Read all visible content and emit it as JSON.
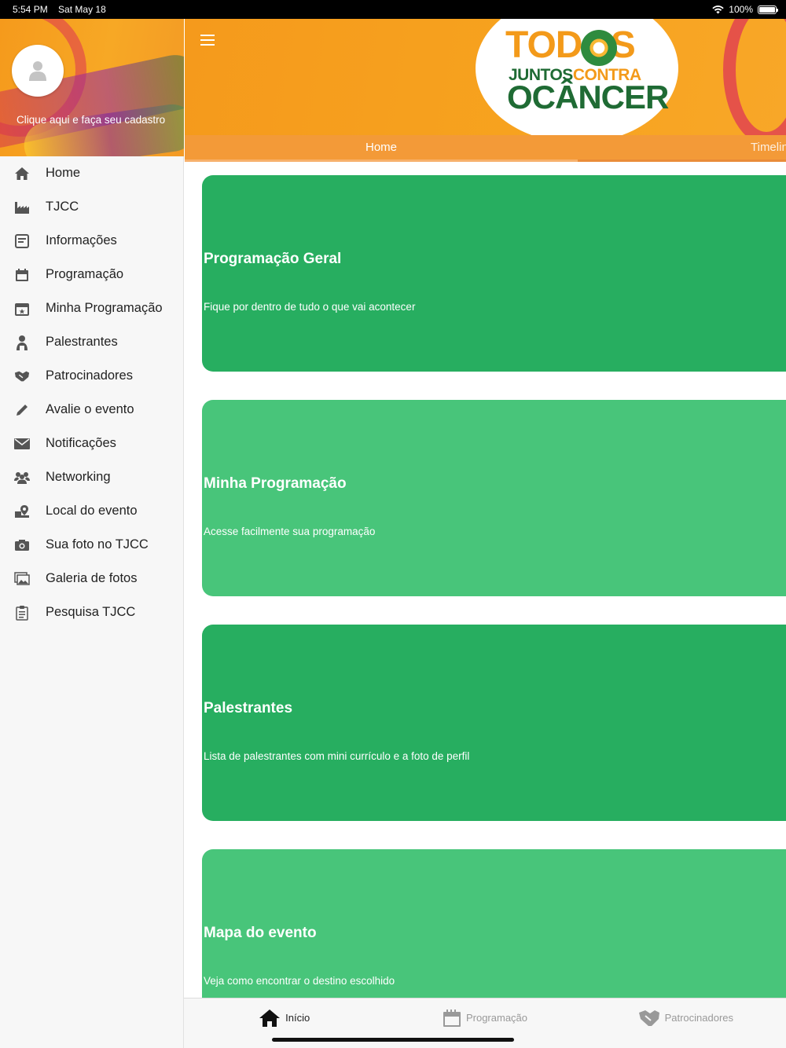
{
  "status_bar": {
    "time": "5:54 PM",
    "date": "Sat May 18",
    "battery": "100%"
  },
  "sidebar": {
    "register_text": "Clique aqui e faça seu cadastro",
    "items": [
      {
        "label": "Home",
        "icon": "home-icon"
      },
      {
        "label": "TJCC",
        "icon": "factory-icon"
      },
      {
        "label": "Informações",
        "icon": "info-card-icon"
      },
      {
        "label": "Programação",
        "icon": "calendar-icon"
      },
      {
        "label": "Minha Programação",
        "icon": "calendar-star-icon"
      },
      {
        "label": "Palestrantes",
        "icon": "speaker-icon"
      },
      {
        "label": "Patrocinadores",
        "icon": "handshake-icon"
      },
      {
        "label": "Avalie o evento",
        "icon": "pencil-icon"
      },
      {
        "label": "Notificações",
        "icon": "mail-icon"
      },
      {
        "label": "Networking",
        "icon": "group-icon"
      },
      {
        "label": "Local do evento",
        "icon": "map-pin-icon"
      },
      {
        "label": "Sua foto no TJCC",
        "icon": "camera-icon"
      },
      {
        "label": "Galeria de fotos",
        "icon": "gallery-icon"
      },
      {
        "label": "Pesquisa TJCC",
        "icon": "clipboard-icon"
      }
    ]
  },
  "header": {
    "logo": {
      "line1": "TODOS",
      "line2a": "JUNTOS",
      "line2b": "CONTRA",
      "line3": "OCÂNCER"
    },
    "tabs": [
      {
        "label": "Home"
      },
      {
        "label": "Timeline"
      }
    ]
  },
  "cards": [
    {
      "title": "Programação Geral",
      "subtitle": "Fique por dentro de tudo o que vai acontecer"
    },
    {
      "title": "Minha Programação",
      "subtitle": "Acesse facilmente sua programação"
    },
    {
      "title": "Palestrantes",
      "subtitle": "Lista de palestrantes com mini currículo e a foto de perfil"
    },
    {
      "title": "Mapa do evento",
      "subtitle": "Veja como encontrar o destino escolhido"
    }
  ],
  "bottom_nav": [
    {
      "label": "Início",
      "icon": "home-icon"
    },
    {
      "label": "Programação",
      "icon": "calendar-icon"
    },
    {
      "label": "Patrocinadores",
      "icon": "handshake-icon"
    }
  ],
  "colors": {
    "accent": "#f7a31f",
    "card_dark": "#27ae60",
    "card_light": "#48c57a",
    "tab_bar": "#f39a38"
  }
}
